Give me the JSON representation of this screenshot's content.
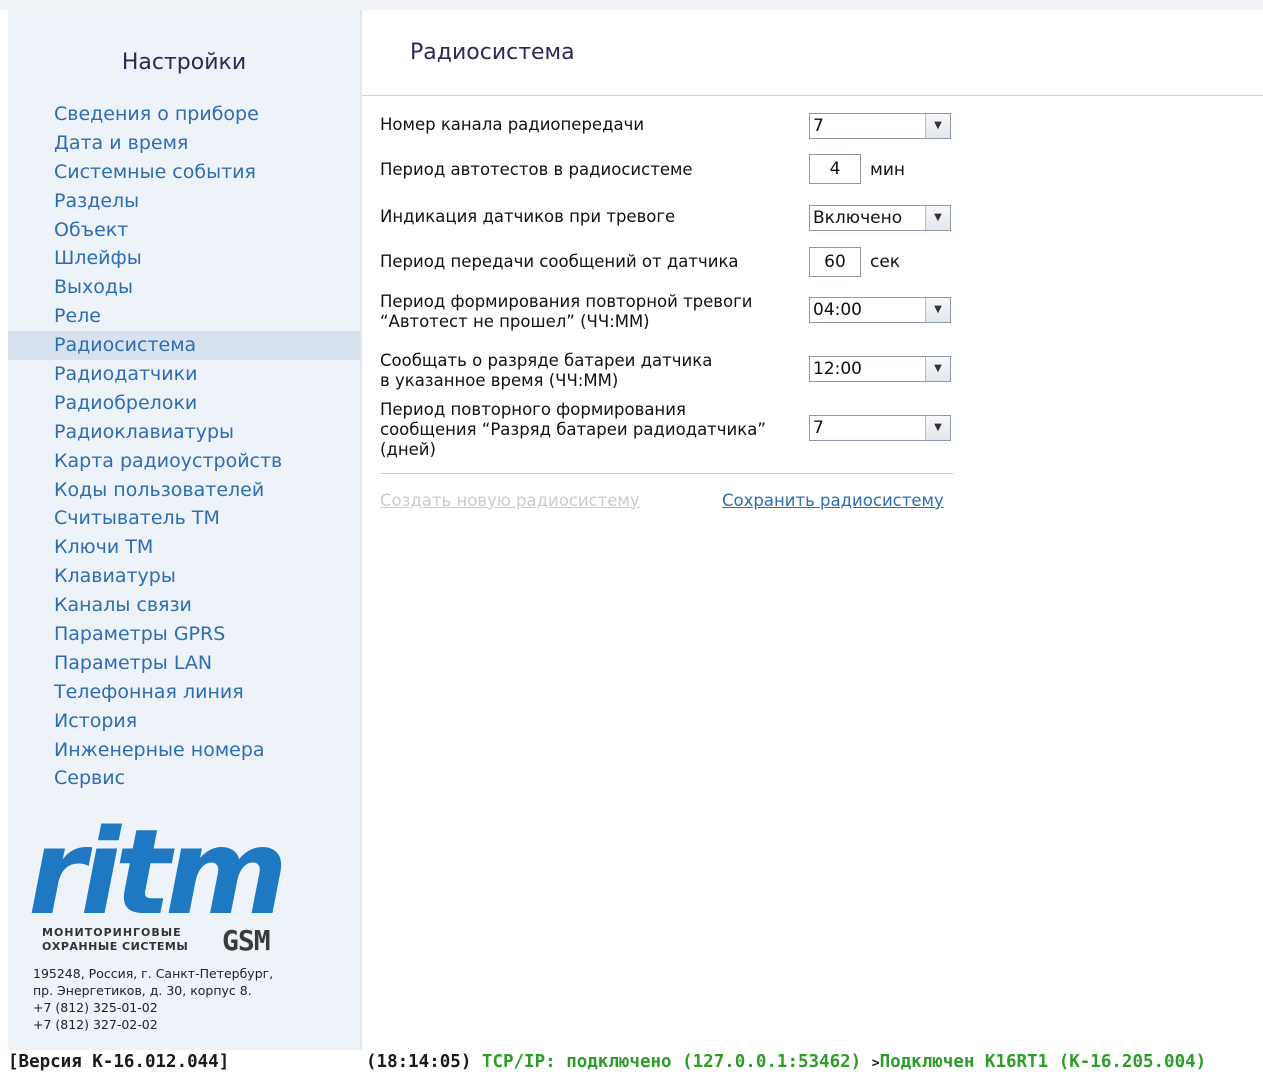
{
  "sidebar": {
    "title": "Настройки",
    "items": [
      {
        "label": "Сведения о приборе"
      },
      {
        "label": "Дата и время"
      },
      {
        "label": "Системные события"
      },
      {
        "label": "Разделы"
      },
      {
        "label": "Объект"
      },
      {
        "label": "Шлейфы"
      },
      {
        "label": "Выходы"
      },
      {
        "label": "Реле"
      },
      {
        "label": "Радиосистема",
        "active": true
      },
      {
        "label": "Радиодатчики"
      },
      {
        "label": "Радиобрелоки"
      },
      {
        "label": "Радиоклавиатуры"
      },
      {
        "label": "Карта радиоустройств"
      },
      {
        "label": "Коды пользователей"
      },
      {
        "label": "Считыватель ТМ"
      },
      {
        "label": "Ключи ТМ"
      },
      {
        "label": "Клавиатуры"
      },
      {
        "label": "Каналы связи"
      },
      {
        "label": "Параметры GPRS"
      },
      {
        "label": "Параметры LAN"
      },
      {
        "label": "Телефонная линия"
      },
      {
        "label": "История"
      },
      {
        "label": "Инженерные номера"
      },
      {
        "label": "Сервис"
      }
    ],
    "logo": {
      "wordmark": "ritm",
      "tagline_1": "МОНИТОРИНГОВЫЕ",
      "tagline_2": "ОХРАННЫЕ СИСТЕМЫ",
      "badge": "GSM",
      "brand_color": "#1e78c2"
    },
    "address": "195248, Россия, г. Санкт-Петербург,\nпр. Энергетиков, д. 30, корпус 8.\n+7 (812) 325-01-02\n+7 (812) 327-02-02"
  },
  "main": {
    "title": "Радиосистема",
    "fields": {
      "channel": {
        "label": "Номер канала радиопередачи",
        "value": "7"
      },
      "autotest_period": {
        "label": "Период автотестов в радиосистеме",
        "value": "4",
        "unit": "мин"
      },
      "alarm_indication": {
        "label": "Индикация датчиков при тревоге",
        "value": "Включено"
      },
      "sensor_msg_period": {
        "label": "Период передачи сообщений от датчика",
        "value": "60",
        "unit": "сек"
      },
      "repeat_alarm_period": {
        "label": "Период формирования повторной тревоги\n“Автотест не прошел” (ЧЧ:ММ)",
        "value": "04:00"
      },
      "battery_report_time": {
        "label": "Сообщать о разряде батареи датчика\nв указанное время (ЧЧ:ММ)",
        "value": "12:00"
      },
      "battery_repeat_period": {
        "label": "Период повторного формирования\nсообщения “Разряд батареи радиодатчика”\n(дней)",
        "value": "7"
      }
    },
    "links": {
      "create": "Создать новую радиосистему",
      "save": "Сохранить радиосистему"
    }
  },
  "status": {
    "version": "[Версия К-16.012.044]",
    "time": "(18:14:05)",
    "tcp": "TCP/IP: подключено (127.0.0.1:53462)",
    "arrow": ">",
    "device": "Подключен K16RT1 (К-16.205.004)"
  },
  "colors": {
    "link": "#2d6db3",
    "status_green": "#2e9c28",
    "sidebar_bg": "#eef2f9",
    "active_bg": "#d8e1ee"
  }
}
